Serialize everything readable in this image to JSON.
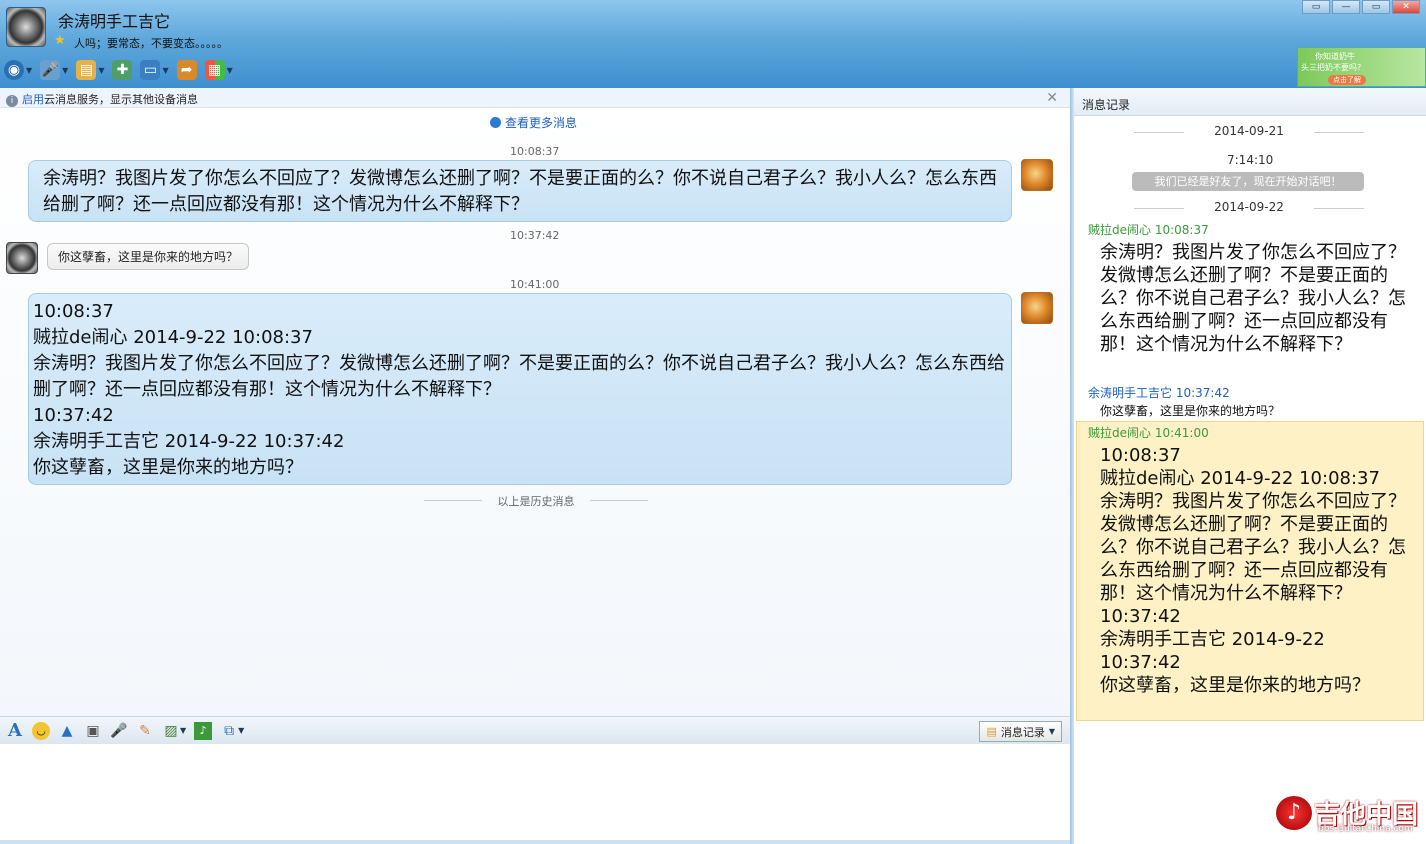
{
  "header": {
    "contact_name": "余涛明手工吉它",
    "signature": "人吗；要常态，不要变态。。。。。",
    "window_controls": [
      "▭",
      "—",
      "▭",
      "✕"
    ]
  },
  "ad": {
    "line1": "你知道奶牛",
    "line2": "头三把奶不要吗?",
    "button": "点击了解"
  },
  "infobar": {
    "link": "启用",
    "text": "云消息服务，显示其他设备消息"
  },
  "chat": {
    "more_messages": "查看更多消息",
    "msg1_time": "10:08:37",
    "msg1_text": "余涛明？我图片发了你怎么不回应了？发微博怎么还删了啊？不是要正面的么？你不说自己君子么？我小人么？怎么东西给删了啊？还一点回应都没有那！这个情况为什么不解释下？",
    "msg2_time": "10:37:42",
    "msg2_text": "你这孽畜，这里是你来的地方吗？",
    "msg3_time": "10:41:00",
    "msg3_lines": [
      "10:08:37",
      "贼拉de闹心 2014-9-22 10:08:37",
      "余涛明？我图片发了你怎么不回应了？发微博怎么还删了啊？不是要正面的么？你不说自己君子么？我小人么？怎么东西给删了啊？还一点回应都没有那！这个情况为什么不解释下？",
      "10:37:42",
      "余涛明手工吉它 2014-9-22 10:37:42",
      "你这孽畜，这里是你来的地方吗？"
    ],
    "history_separator": "以上是历史消息"
  },
  "inputbar": {
    "history_button": "消息记录"
  },
  "sidepanel": {
    "title": "消息记录",
    "date1": "2014-09-21",
    "time1": "7:14:10",
    "system_note": "我们已经是好友了，现在开始对话吧！",
    "date2": "2014-09-22",
    "entry1_name": "贼拉de闹心 10:08:37",
    "entry1_text": "余涛明？我图片发了你怎么不回应了？发微博怎么还删了啊？不是要正面的么？你不说自己君子么？我小人么？怎么东西给删了啊？还一点回应都没有那！这个情况为什么不解释下？",
    "entry2_name": "余涛明手工吉它 10:37:42",
    "entry2_text": "你这孽畜，这里是你来的地方吗？",
    "entry3_name": "贼拉de闹心 10:41:00",
    "entry3_lines": [
      "10:08:37",
      "贼拉de闹心 2014-9-22 10:08:37",
      "余涛明？我图片发了你怎么不回应了？发微博怎么还删了啊？不是要正面的么？你不说自己君子么？我小人么？怎么东西给删了啊？还一点回应都没有那！这个情况为什么不解释下？",
      "10:37:42",
      "余涛明手工吉它 2014-9-22 10:37:42",
      "你这孽畜，这里是你来的地方吗？"
    ]
  },
  "watermark": {
    "text": "吉他中国",
    "url": "bbs.GuitarChina.com"
  },
  "colors": {
    "sender_name": "#3a9a3a",
    "receiver_name": "#1e5fbf",
    "link": "#1e5fbf"
  }
}
